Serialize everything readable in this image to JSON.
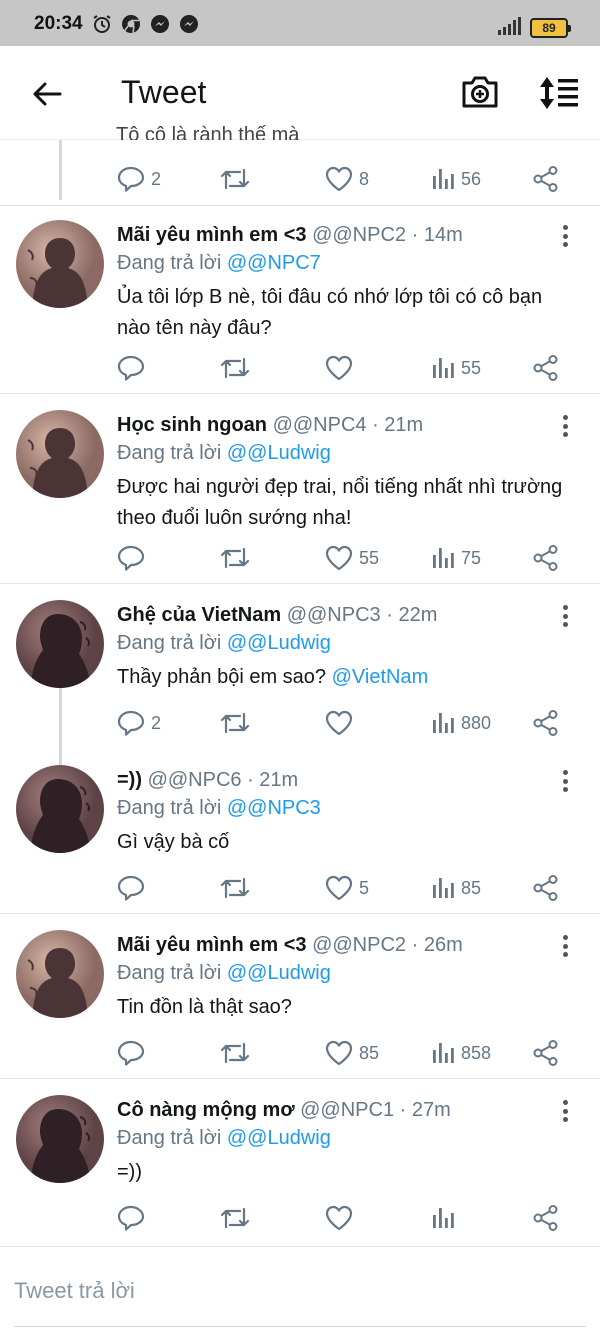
{
  "status_bar": {
    "time": "20:34",
    "battery": "89",
    "icons": [
      "alarm-icon",
      "chrome-icon",
      "messenger-icon",
      "messenger-icon"
    ]
  },
  "header": {
    "title": "Tweet",
    "back_icon": "arrow-left-icon",
    "camera_icon": "camera-plus-icon",
    "sort_icon": "sort-icon"
  },
  "partial_tweet": {
    "text": "Tô cô là rành thế mà",
    "replies": "2",
    "retweets": "",
    "likes": "8",
    "views": "56"
  },
  "tweets": [
    {
      "name": "Mãi yêu mình em <3",
      "handle": "@@NPC2",
      "time": "· 14m",
      "reply_prefix": "Đang trả lời",
      "reply_to": "@@NPC7",
      "text": "Ủa tôi lớp B nè,  tôi đâu có nhớ lớp tôi có cô bạn nào tên này đâu?",
      "mention": "",
      "replies": "",
      "likes": "",
      "views": "55"
    },
    {
      "name": "Học sinh ngoan",
      "handle": "@@NPC4",
      "time": "· 21m",
      "reply_prefix": "Đang trả lời",
      "reply_to": "@@Ludwig",
      "text": "Được hai người đẹp trai,  nổi tiếng nhất nhì trường theo đuổi luôn sướng nha!",
      "mention": "",
      "replies": "",
      "likes": "55",
      "views": "75"
    },
    {
      "name": "Ghệ của VietNam",
      "handle": "@@NPC3",
      "time": "· 22m",
      "reply_prefix": "Đang trả lời",
      "reply_to": "@@Ludwig",
      "text": "Thầy phản bội em sao?  ",
      "mention": "@VietNam",
      "replies": "2",
      "likes": "",
      "views": "880"
    },
    {
      "name": "=))",
      "handle": "@@NPC6",
      "time": "· 21m",
      "reply_prefix": "Đang trả lời",
      "reply_to": "@@NPC3",
      "text": "Gì vậy bà cố",
      "mention": "",
      "replies": "",
      "likes": "5",
      "views": "85"
    },
    {
      "name": "Mãi yêu mình em <3",
      "handle": "@@NPC2",
      "time": "· 26m",
      "reply_prefix": "Đang trả lời",
      "reply_to": "@@Ludwig",
      "text": "Tin đồn là thật sao?",
      "mention": "",
      "replies": "",
      "likes": "85",
      "views": "858"
    },
    {
      "name": "Cô nàng mộng mơ",
      "handle": "@@NPC1",
      "time": "· 27m",
      "reply_prefix": "Đang trả lời",
      "reply_to": "@@Ludwig",
      "text": "=))",
      "mention": "",
      "replies": "",
      "likes": "",
      "views": ""
    }
  ],
  "composer": {
    "placeholder": "Tweet trả lời"
  },
  "colors": {
    "link": "#1d9bf0",
    "muted": "#657786",
    "status_bar": "#c6c6c6",
    "battery": "#f0c040"
  }
}
